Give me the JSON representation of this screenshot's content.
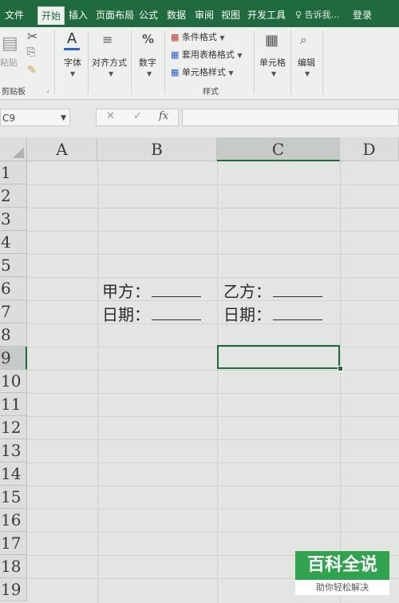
{
  "ribbon_tabs": [
    "文件",
    "开始",
    "插入",
    "页面布局",
    "公式",
    "数据",
    "审阅",
    "视图",
    "开发工具"
  ],
  "active_tab": "开始",
  "tell_me": "告诉我...",
  "login": "登录",
  "ribbon": {
    "paste_label": "粘贴",
    "clipboard_label": "剪贴板",
    "font_label": "字体",
    "align_label": "对齐方式",
    "number_label": "数字",
    "cond_format": "条件格式",
    "table_format": "套用表格格式",
    "cell_style": "单元格样式",
    "styles_label": "样式",
    "cells_label": "单元格",
    "edit_label": "编辑"
  },
  "name_box": "C9",
  "formula_icons": {
    "cancel": "✕",
    "enter": "✓",
    "fx": "fx"
  },
  "columns": [
    "A",
    "B",
    "C",
    "D"
  ],
  "selected_column": "C",
  "rows": [
    "1",
    "2",
    "3",
    "4",
    "5",
    "6",
    "7",
    "8",
    "9",
    "10",
    "11",
    "12",
    "13",
    "14",
    "15",
    "16",
    "17",
    "18",
    "19"
  ],
  "selected_row": "9",
  "selected_cell": "C9",
  "cells": {
    "b6": "甲方：",
    "c6": "乙方：",
    "b7": "日期：",
    "c7": "日期："
  },
  "watermark": {
    "title": "百科全说",
    "subtitle": "助你轻松解决"
  },
  "colors": {
    "accent": "#1f6b3f",
    "watermark": "#2fa34e"
  }
}
